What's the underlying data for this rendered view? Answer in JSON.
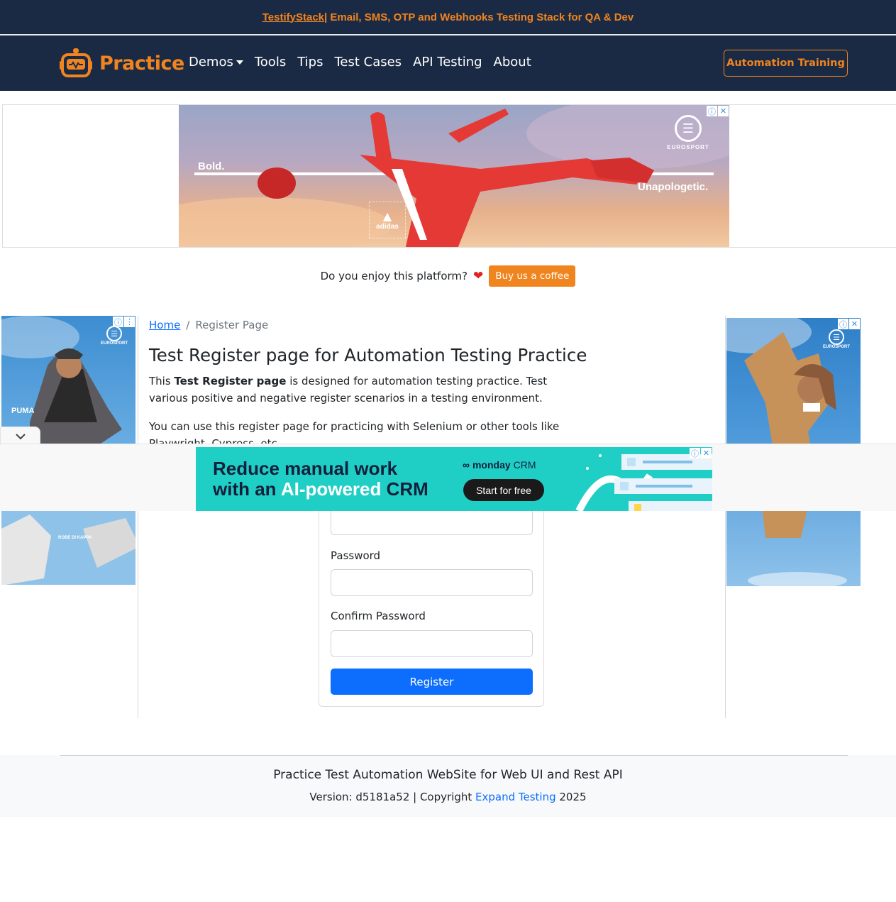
{
  "promo": {
    "link_text": "TestifyStack",
    "rest_text": " | Email, SMS, OTP and Webhooks Testing Stack for QA & Dev"
  },
  "navbar": {
    "brand": "Practice",
    "links": [
      "Demos",
      "Tools",
      "Tips",
      "Test Cases",
      "API Testing",
      "About"
    ],
    "training_button": "Automation Training"
  },
  "top_ad": {
    "left_text": "Bold.",
    "right_text": "Unapologetic.",
    "brand_logo": "EUROSPORT",
    "sub_brand": "adidas"
  },
  "coffee": {
    "question": "Do you enjoy this platform?",
    "heart": "❤",
    "button": "Buy us a coffee"
  },
  "side_ads": {
    "left_brand": "EUROSPORT",
    "left_sponsor": "PUMA",
    "left_bottom_sponsor": "ROBE DI KAPPA",
    "right_brand": "EUROSPORT"
  },
  "breadcrumb": {
    "home": "Home",
    "separator": "/",
    "current": "Register Page"
  },
  "main": {
    "title": "Test Register page for Automation Testing Practice",
    "intro_prefix": "This ",
    "intro_bold": "Test Register page",
    "intro_suffix": " is designed for automation testing practice. Test various positive and negative register scenarios in a testing environment.",
    "intro2": "You can use this register page for practicing with Selenium or other tools like Playwright, Cypress, etc."
  },
  "anchor_ad": {
    "line1": "Reduce manual work",
    "line2_prefix": "with an ",
    "line2_highlight": "AI-powered",
    "line2_suffix": " CRM",
    "brand_bold": "monday",
    "brand_rest": "CRM",
    "button": "Start for free"
  },
  "form": {
    "username_value": "",
    "password_label": "Password",
    "password_value": "",
    "confirm_label": "Confirm Password",
    "confirm_value": "",
    "submit": "Register"
  },
  "footer": {
    "title": "Practice Test Automation WebSite for Web UI and Rest API",
    "version_prefix": "Version: d5181a52 | Copyright ",
    "company": "Expand Testing",
    "year": " 2025"
  },
  "ad_controls": {
    "info": "ⓘ",
    "close": "✕",
    "menu": "⋮"
  }
}
